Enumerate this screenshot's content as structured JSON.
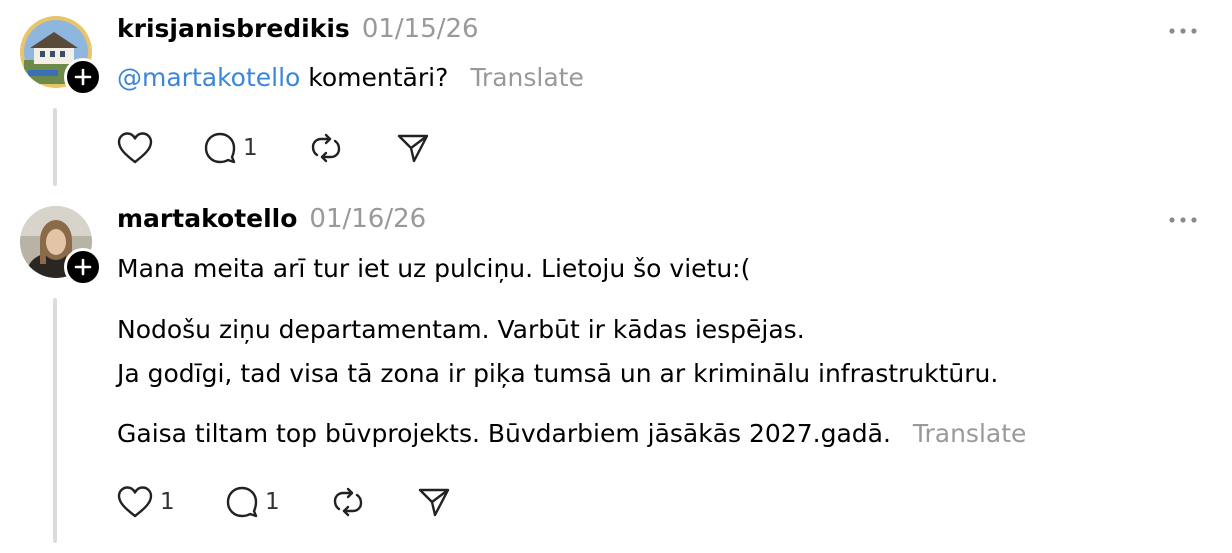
{
  "posts": [
    {
      "username": "krisjanisbredikis",
      "date": "01/15/26",
      "mention": "@martakotello",
      "text": "komentāri?",
      "translate_label": "Translate",
      "like_count": "",
      "reply_count": "1",
      "avatar_icon": "house-photo-avatar"
    },
    {
      "username": "martakotello",
      "date": "01/16/26",
      "lines": [
        "Mana meita arī tur iet uz pulciņu. Lietoju šo vietu:(",
        "Nodošu ziņu departamentam. Varbūt ir kādas iespējas.",
        "Ja godīgi, tad visa tā zona ir piķa tumsā un ar kriminālu infrastruktūru.",
        "Gaisa tiltam top būvprojekts. Būvdarbiem jāsākās 2027.gadā."
      ],
      "translate_label": "Translate",
      "like_count": "1",
      "reply_count": "1",
      "avatar_icon": "person-photo-avatar"
    }
  ],
  "colors": {
    "mention": "#3b86d8",
    "muted": "#999999",
    "thread_line": "#dcdcdc"
  }
}
